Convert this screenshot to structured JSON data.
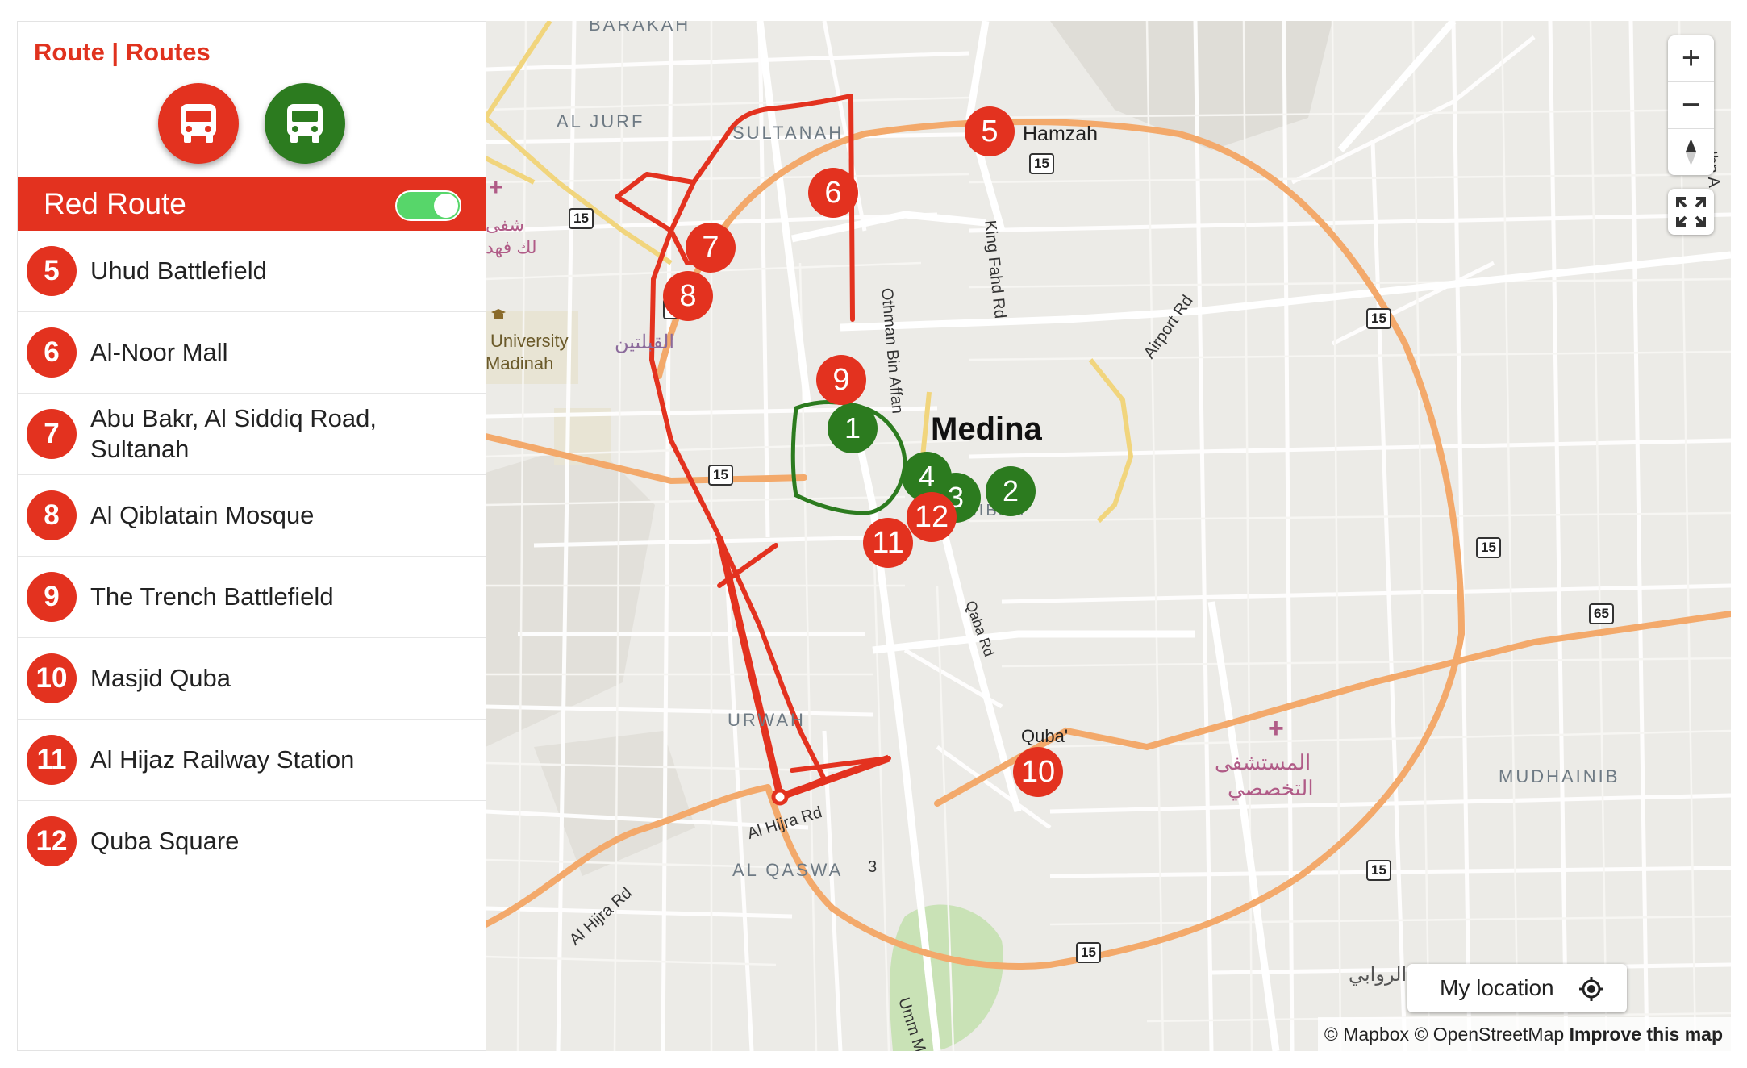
{
  "panel": {
    "heading": "Route | Routes",
    "route_buttons": [
      {
        "name": "red-bus",
        "color": "#e3321f"
      },
      {
        "name": "green-bus",
        "color": "#2c7b1f"
      }
    ],
    "selected_route": {
      "title": "Red Route",
      "toggle_on": true,
      "color": "#e3321f"
    },
    "stops": [
      {
        "number": "5",
        "name": "Uhud Battlefield"
      },
      {
        "number": "6",
        "name": "Al-Noor Mall"
      },
      {
        "number": "7",
        "name": "Abu Bakr, Al Siddiq Road, Sultanah"
      },
      {
        "number": "8",
        "name": "Al Qiblatain Mosque"
      },
      {
        "number": "9",
        "name": "The Trench Battlefield"
      },
      {
        "number": "10",
        "name": "Masjid Quba"
      },
      {
        "number": "11",
        "name": "Al Hijaz Railway Station"
      },
      {
        "number": "12",
        "name": "Quba Square"
      }
    ]
  },
  "map": {
    "labels": {
      "barakah": "BARAKAH",
      "al_jurf": "AL JURF",
      "sultanah": "SULTANAH",
      "hamzah": "Hamzah",
      "othman": "Othman Bin Affan",
      "king_fahd": "King Fahd Rd",
      "airport": "Airport Rd",
      "university": "University",
      "madinah": "Madinah",
      "qiblatain_ar": "القبلتين",
      "shifa_ar": "شفى",
      "fahd_ar": "لك فهد",
      "medina": "Medina",
      "shibah": "SHIBAH",
      "qaba_rd": "Qaba Rd",
      "urwah": "URWAH",
      "quba": "Quba'",
      "hospital_ar_1": "المستشفى",
      "hospital_ar_2": "التخصصي",
      "mudhainib": "MUDHAINIB",
      "al_hijra_1": "Al Hijra Rd",
      "al_hijra_2": "Al Hijra Rd",
      "al_qaswa": "AL QASWA",
      "qaswa_num": "3",
      "umm": "Umm M",
      "rawabi_ar": "الروابي",
      "ibn": "Ibn A"
    },
    "shields": [
      "15",
      "15",
      "15",
      "15",
      "15",
      "15",
      "15",
      "15",
      "65"
    ],
    "red_markers": [
      "5",
      "6",
      "7",
      "8",
      "9",
      "10",
      "11",
      "12"
    ],
    "green_markers": [
      "1",
      "2",
      "3",
      "4"
    ],
    "colors": {
      "red_route": "#e3321f",
      "green_route": "#2c7b1f",
      "ring_road": "#f3a96b",
      "land": "#ecebe7"
    },
    "controls": {
      "zoom_in": "+",
      "zoom_out": "−",
      "compass": "compass",
      "fullscreen": "fullscreen"
    },
    "my_location_label": "My location",
    "attribution": {
      "mapbox": "© Mapbox",
      "osm": "© OpenStreetMap",
      "improve": "Improve this map"
    }
  }
}
